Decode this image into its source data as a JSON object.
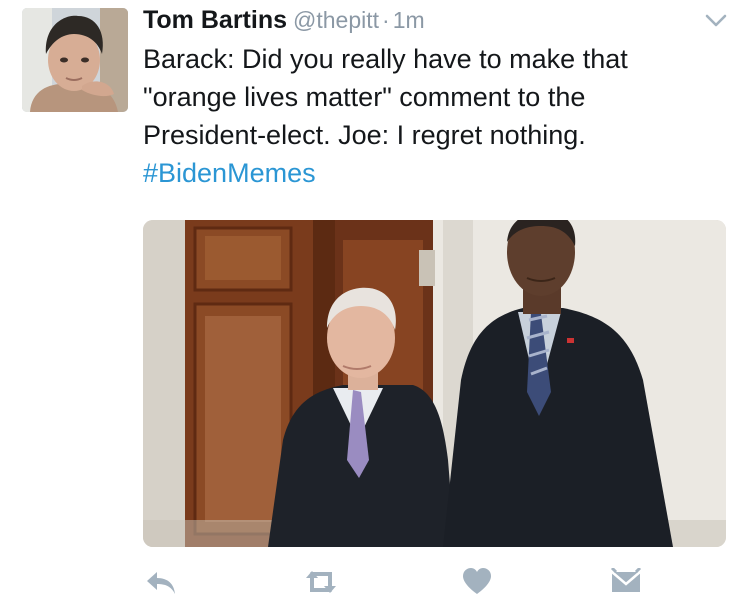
{
  "tweet": {
    "author_name": "Tom Bartins",
    "handle": "@thepitt",
    "separator": "·",
    "time": "1m",
    "text_lines": [
      "Barack: Did you really have to make that",
      "\"orange lives matter\" comment to the",
      "President-elect. Joe: I regret nothing."
    ],
    "hashtag": "#BidenMemes"
  },
  "icons": {
    "menu": "chevron-down-icon",
    "reply": "reply-icon",
    "retweet": "retweet-icon",
    "like": "heart-icon",
    "message": "direct-message-icon"
  },
  "colors": {
    "link": "#2b96d4",
    "secondary": "#8b98a5",
    "icon": "#a3b2bf"
  }
}
